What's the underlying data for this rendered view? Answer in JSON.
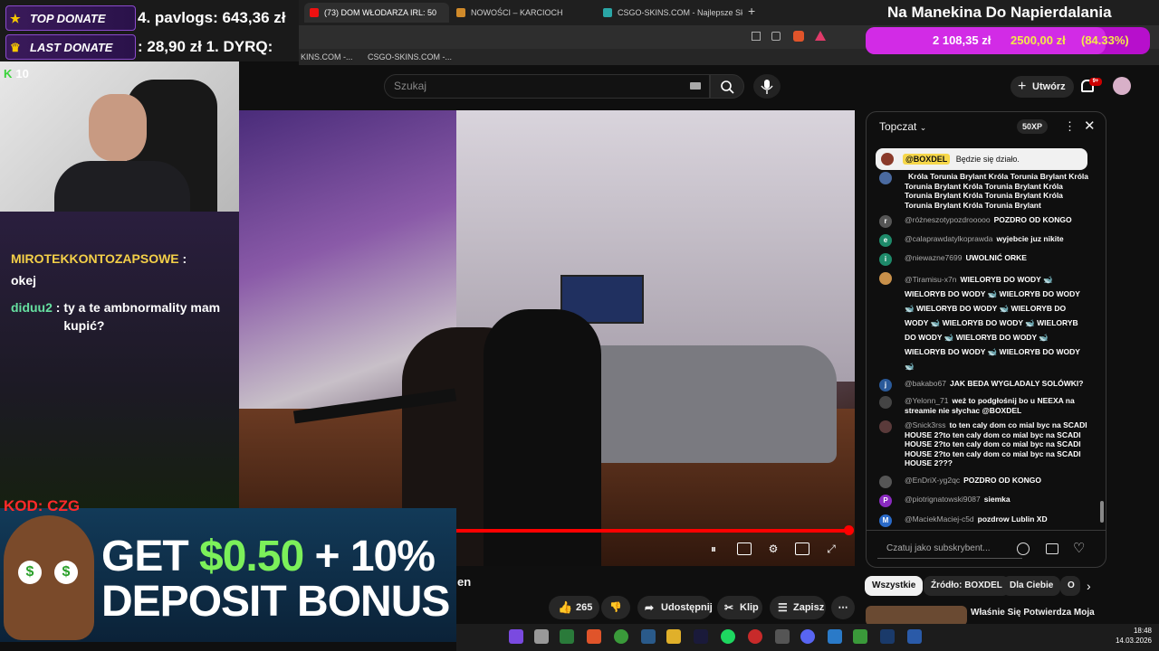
{
  "browser": {
    "tabs": [
      {
        "label": "(73) DOM WŁODARZA IRL: 50",
        "active": true
      },
      {
        "label": "NOWOŚCI – KARCIOCH",
        "active": false
      },
      {
        "label": "CSGO-SKINS.COM - Najlepsze Skrzyn",
        "active": false
      }
    ],
    "bookmarks": [
      "KINS.COM -...",
      "CSGO-SKINS.COM -..."
    ]
  },
  "youtube": {
    "search_placeholder": "Szukaj",
    "create_label": "Utwórz",
    "notif_count": "9+",
    "video_title_fragment": "en",
    "actions": {
      "likes": "265",
      "share": "Udostępnij",
      "clip": "Klip",
      "save": "Zapisz"
    },
    "chips": [
      "Wszystkie",
      "Źródło: BOXDEL",
      "Dla Ciebie",
      "O"
    ],
    "suggestion_title": "Właśnie Się Potwierdza Moja"
  },
  "chat": {
    "header": "Topczat",
    "xp": "50XP",
    "pinned": {
      "author": "@BOXDEL",
      "text": "Będzie się działo."
    },
    "messages": [
      {
        "author": "",
        "text": "Króla Torunia Brylant Króla Torunia Brylant Króla Torunia Brylant Króla Torunia Brylant Króla Torunia Brylant Króla Torunia Brylant Króla Torunia Brylant Króla Torunia Brylant",
        "avatar": ""
      },
      {
        "author": "@różneszotypozdrooooo",
        "text": "POZDRO OD KONGO",
        "avatar": "r"
      },
      {
        "author": "@calaprawdatylkoprawda",
        "text": "wyjebcie juz nikite",
        "avatar": "e"
      },
      {
        "author": "@niewazne7699",
        "text": "UWOLNIĆ ORKE",
        "avatar": "i"
      },
      {
        "author": "@Tiramisu-x7n",
        "text": "WIELORYB DO WODY 🐋 WIELORYB DO WODY 🐋 WIELORYB DO WODY 🐋 WIELORYB DO WODY 🐋 WIELORYB DO WODY 🐋 WIELORYB DO WODY 🐋 WIELORYB DO WODY 🐋 WIELORYB DO WODY 🐋 WIELORYB DO WODY 🐋 WIELORYB DO WODY 🐋",
        "avatar": "t"
      },
      {
        "author": "@bakabo67",
        "text": "JAK BEDA WYGLADALY SOLÓWKI?",
        "avatar": "j"
      },
      {
        "author": "@Yelonn_71",
        "text": "weż to podgłośnij bo u NEEXA na streamie nie słychac @BOXDEL",
        "avatar": "y"
      },
      {
        "author": "@Snick3rss",
        "text": "to ten caly dom co mial byc na SCADI HOUSE 2?to ten caly dom co mial byc na SCADI HOUSE 2?to ten caly dom co mial byc na SCADI HOUSE 2?to ten caly dom co mial byc na SCADI HOUSE 2???",
        "avatar": "s"
      },
      {
        "author": "@EnDriX-yg2qc",
        "text": "POZDRO OD KONGO",
        "avatar": "e"
      },
      {
        "author": "@piotrignatowski9087",
        "text": "siemka",
        "avatar": "P"
      },
      {
        "author": "@MaciekMaciej-c5d",
        "text": "pozdrow Lublin XD",
        "avatar": "M"
      }
    ],
    "input_placeholder": "Czatuj jako subskrybent..."
  },
  "overlay": {
    "top_donate_label": "TOP DONATE",
    "top_donate_value": "4. pavlogs: 643,36 zł",
    "last_donate_label": "LAST DONATE",
    "last_donate_value": ": 28,90 zł 1. DYRQ:",
    "goal_title": "Na Manekina Do Napierdalania",
    "goal_current": "2 108,35 zł",
    "goal_target": "2500,00 zł",
    "goal_percent": "(84.33%)",
    "goal_fraction": 0.8433,
    "cam_count": "10",
    "stream_chat": [
      {
        "name": "MIROTEKKONTOZAPSOWE",
        "text": "okej"
      },
      {
        "name": "diduu2",
        "text": "ty a te ambnormality mam kupić?"
      }
    ],
    "promo_code": "KOD: CZG",
    "promo_line1_a": "GET ",
    "promo_line1_b": "$0.50",
    "promo_line1_c": " + 10%",
    "promo_line2": "DEPOSIT BONUS"
  },
  "taskbar": {
    "time": "18:48",
    "date": "14.03.2026"
  }
}
